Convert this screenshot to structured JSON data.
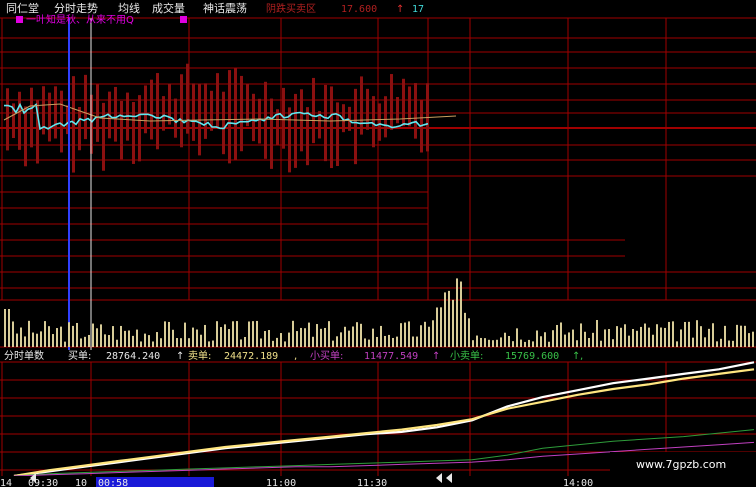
{
  "header": {
    "stock_name": "同仁堂",
    "menu": [
      "分时走势",
      "均线",
      "成交量",
      "神话震荡"
    ],
    "price_label": "阴跌买卖区",
    "price_value": "17.600",
    "price_arrow": "↑",
    "price_extra": "17"
  },
  "legend": {
    "text": "一叶知是秋、从来不用Q"
  },
  "lower_panel": {
    "title": "分时单数",
    "buy": {
      "label": "买单:",
      "value": "28764.240"
    },
    "sell": {
      "label": "卖单:",
      "value": "24472.189"
    },
    "small_buy": {
      "label": "小买单:",
      "value": "11477.549"
    },
    "small_sell": {
      "label": "小卖单:",
      "value": "15769.600"
    },
    "arrow": "↑",
    "comma": ","
  },
  "time_axis": {
    "labels": [
      "14",
      "09:30",
      "10",
      "00:58",
      "11:00",
      "11:30",
      "14:00"
    ]
  },
  "watermark": "www.7gpzb.com",
  "colors": {
    "grid": "#a00000",
    "white_line": "#ffffff",
    "yellow_line": "#ffe680",
    "green_line": "#2e9c3a",
    "purple_line": "#c040c0",
    "cyan_line": "#60e8f0",
    "bar_dark_red": "#8b1010",
    "volume": "#d8cc98",
    "magenta": "#e000e0"
  },
  "chart_data": [
    {
      "type": "line",
      "title": "分时单数",
      "series": [
        {
          "name": "买单",
          "values": [
            0,
            4,
            8,
            12,
            16,
            20,
            24,
            27,
            30,
            33,
            36,
            38,
            42,
            48,
            60,
            68,
            74,
            80,
            84,
            88,
            92,
            98
          ]
        },
        {
          "name": "卖单",
          "values": [
            0,
            5,
            9,
            13,
            17,
            21,
            25,
            28,
            31,
            34,
            37,
            40,
            44,
            49,
            58,
            64,
            70,
            75,
            79,
            84,
            88,
            92
          ]
        },
        {
          "name": "小卖单",
          "values": [
            0,
            2,
            3,
            4,
            5,
            6,
            7,
            8,
            9,
            10,
            11,
            12,
            13,
            14,
            18,
            24,
            27,
            30,
            32,
            34,
            37,
            40
          ]
        },
        {
          "name": "小买单",
          "values": [
            0,
            1,
            2,
            3,
            4,
            5,
            6,
            7,
            8,
            8,
            9,
            10,
            11,
            12,
            14,
            17,
            19,
            21,
            23,
            25,
            27,
            29
          ]
        }
      ]
    }
  ]
}
